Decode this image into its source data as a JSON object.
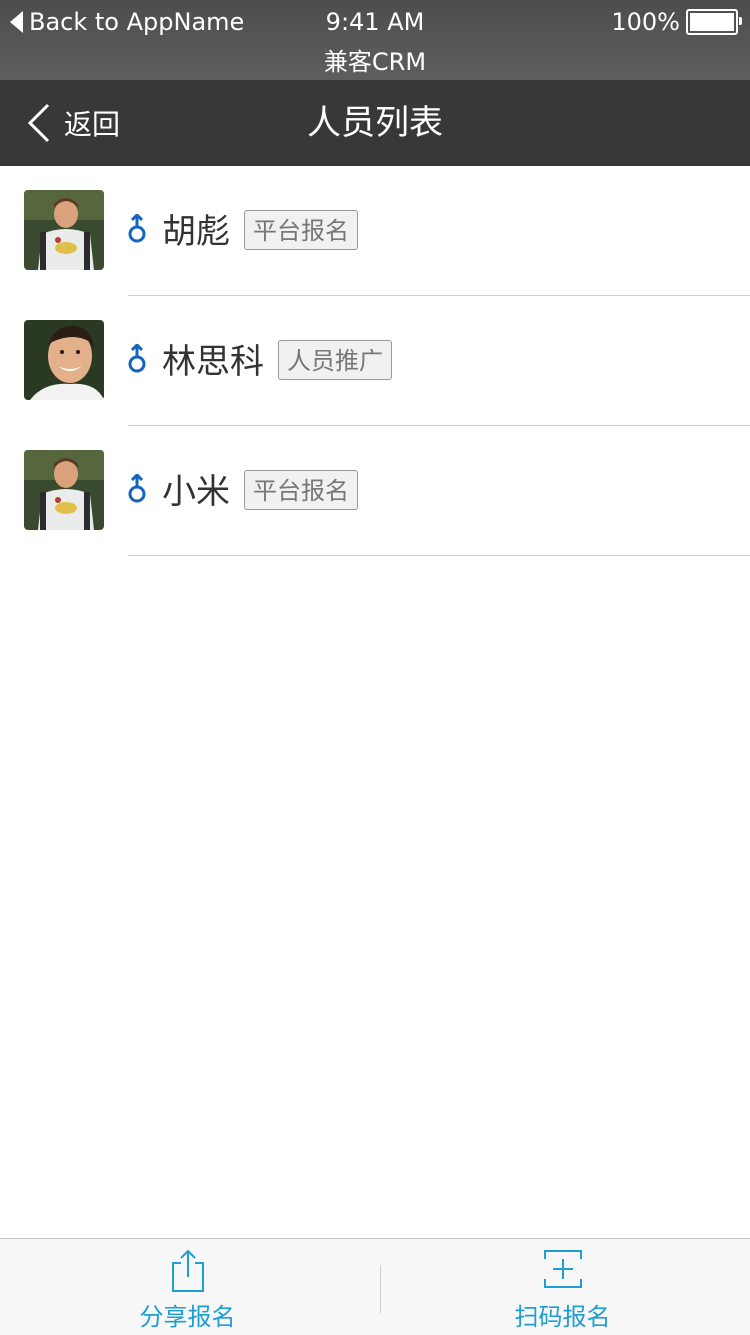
{
  "status_bar": {
    "back_label": "Back to AppName",
    "time": "9:41 AM",
    "app_name": "兼客CRM",
    "battery": "100%"
  },
  "nav": {
    "back_label": "返回",
    "title": "人员列表"
  },
  "people": [
    {
      "name": "胡彪",
      "tag": "平台报名",
      "gender": "male-icon"
    },
    {
      "name": "林思科",
      "tag": "人员推广",
      "gender": "male-icon"
    },
    {
      "name": "小米",
      "tag": "平台报名",
      "gender": "male-icon"
    }
  ],
  "tabs": [
    {
      "label": "分享报名",
      "icon": "share-icon"
    },
    {
      "label": "扫码报名",
      "icon": "scan-icon"
    }
  ],
  "colors": {
    "accent": "#1f9fd0",
    "gender_icon": "#1565c0",
    "nav_bg": "#383838"
  }
}
